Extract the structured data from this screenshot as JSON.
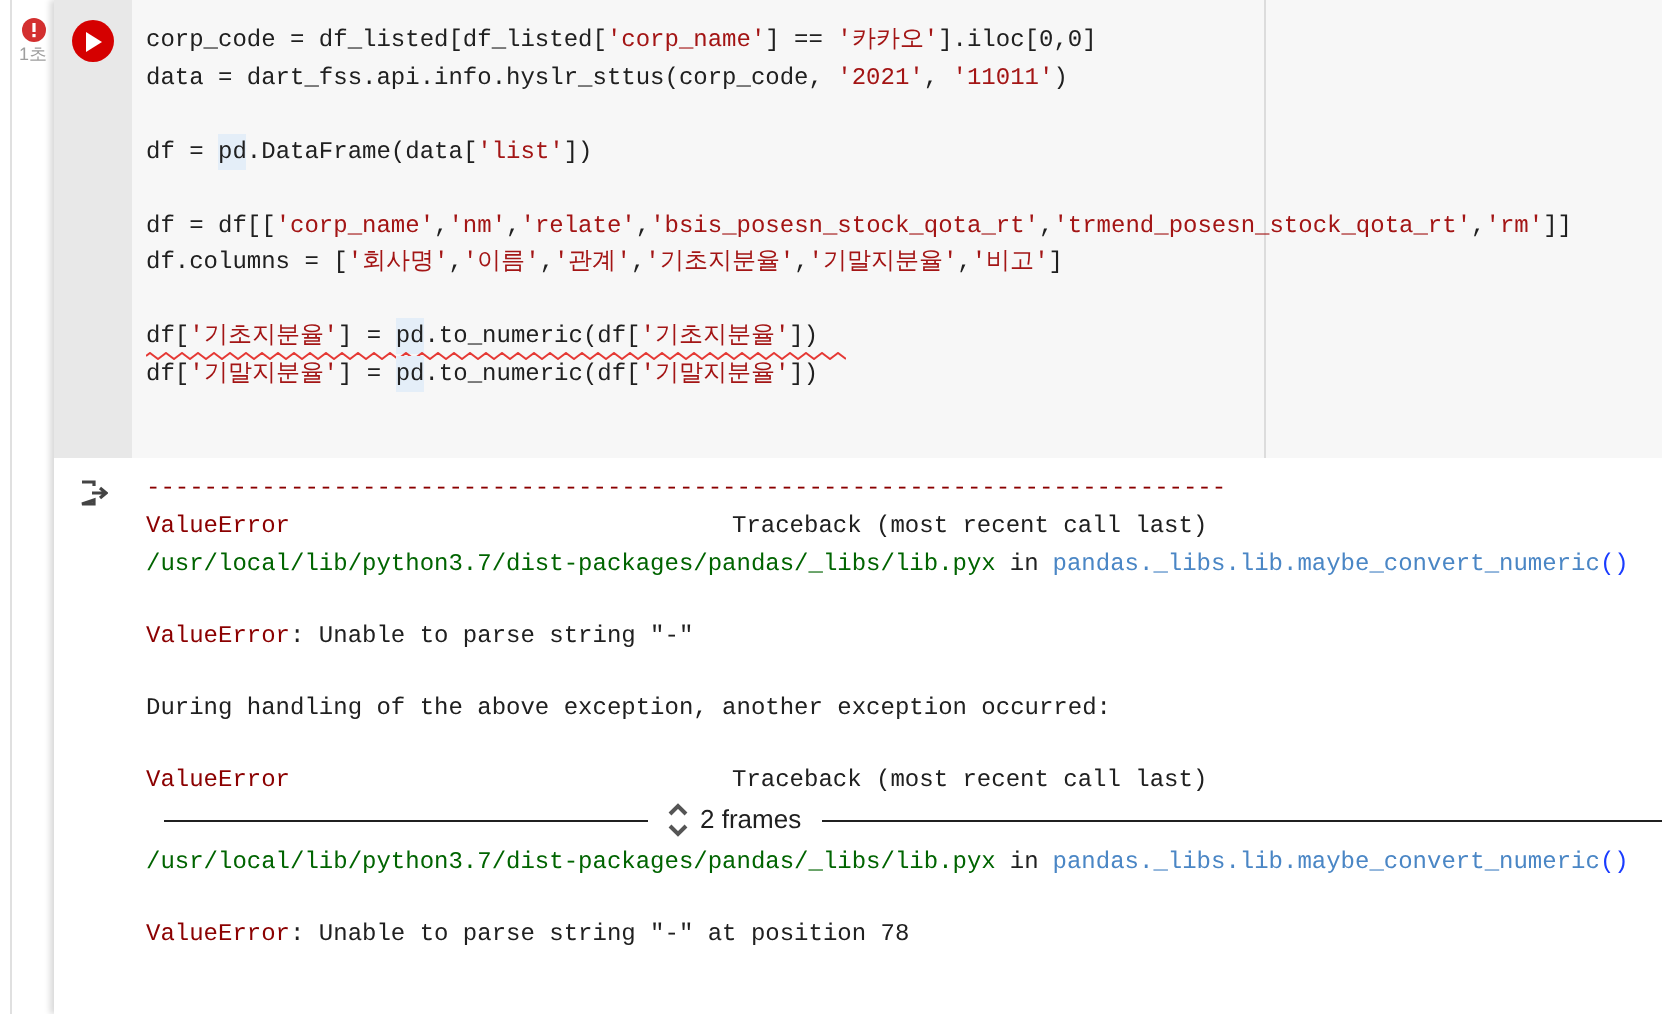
{
  "cell_status": {
    "error": true,
    "duration": "1초"
  },
  "code_blocks": [
    [
      {
        "squiggle": false,
        "tokens": [
          {
            "kind": "code",
            "text": "corp_code = df_listed[df_listed["
          },
          {
            "kind": "string",
            "text": "'corp_name'"
          },
          {
            "kind": "code",
            "text": "] == "
          },
          {
            "kind": "string",
            "text": "'카카오'"
          },
          {
            "kind": "code",
            "text": "].iloc[0,0]"
          }
        ]
      },
      {
        "squiggle": false,
        "tokens": [
          {
            "kind": "code",
            "text": "data = dart_fss.api.info.hyslr_sttus(corp_code, "
          },
          {
            "kind": "string",
            "text": "'2021'"
          },
          {
            "kind": "code",
            "text": ", "
          },
          {
            "kind": "string",
            "text": "'11011'"
          },
          {
            "kind": "code",
            "text": ")"
          }
        ]
      }
    ],
    [
      {
        "squiggle": false,
        "tokens": [
          {
            "kind": "code",
            "text": "df = "
          },
          {
            "kind": "match",
            "text": "pd"
          },
          {
            "kind": "code",
            "text": ".DataFrame(data["
          },
          {
            "kind": "string",
            "text": "'list'"
          },
          {
            "kind": "code",
            "text": "])"
          }
        ]
      }
    ],
    [
      {
        "squiggle": false,
        "tokens": [
          {
            "kind": "code",
            "text": "df = df[["
          },
          {
            "kind": "string",
            "text": "'corp_name'"
          },
          {
            "kind": "code",
            "text": ","
          },
          {
            "kind": "string",
            "text": "'nm'"
          },
          {
            "kind": "code",
            "text": ","
          },
          {
            "kind": "string",
            "text": "'relate'"
          },
          {
            "kind": "code",
            "text": ","
          },
          {
            "kind": "string",
            "text": "'bsis_posesn_stock_qota_rt'"
          },
          {
            "kind": "code",
            "text": ","
          },
          {
            "kind": "string",
            "text": "'trmend_posesn_stock_qota_rt'"
          },
          {
            "kind": "code",
            "text": ","
          },
          {
            "kind": "string",
            "text": "'rm'"
          },
          {
            "kind": "code",
            "text": "]]"
          }
        ]
      },
      {
        "squiggle": false,
        "tokens": [
          {
            "kind": "code",
            "text": "df.columns = ["
          },
          {
            "kind": "string",
            "text": "'회사명'"
          },
          {
            "kind": "code",
            "text": ","
          },
          {
            "kind": "string",
            "text": "'이름'"
          },
          {
            "kind": "code",
            "text": ","
          },
          {
            "kind": "string",
            "text": "'관계'"
          },
          {
            "kind": "code",
            "text": ","
          },
          {
            "kind": "string",
            "text": "'기초지분율'"
          },
          {
            "kind": "code",
            "text": ","
          },
          {
            "kind": "string",
            "text": "'기말지분율'"
          },
          {
            "kind": "code",
            "text": ","
          },
          {
            "kind": "string",
            "text": "'비고'"
          },
          {
            "kind": "code",
            "text": "]"
          }
        ]
      }
    ],
    [
      {
        "squiggle": true,
        "tokens": [
          {
            "kind": "code",
            "text": "df["
          },
          {
            "kind": "string",
            "text": "'기초지분율'"
          },
          {
            "kind": "code",
            "text": "] = "
          },
          {
            "kind": "match",
            "text": "pd"
          },
          {
            "kind": "code",
            "text": ".to_numeric(df["
          },
          {
            "kind": "string",
            "text": "'기초지분율'"
          },
          {
            "kind": "code",
            "text": "])"
          }
        ]
      },
      {
        "squiggle": false,
        "tokens": [
          {
            "kind": "code",
            "text": "df["
          },
          {
            "kind": "string",
            "text": "'기말지분율'"
          },
          {
            "kind": "code",
            "text": "] = "
          },
          {
            "kind": "match",
            "text": "pd"
          },
          {
            "kind": "code",
            "text": ".to_numeric(df["
          },
          {
            "kind": "string",
            "text": "'기말지분율'"
          },
          {
            "kind": "code",
            "text": "])"
          }
        ]
      }
    ]
  ],
  "output_blocks": [
    [
      {
        "kind": "dashes",
        "text": "---------------------------------------------------------------------------"
      },
      {
        "kind": "header",
        "error": "ValueError",
        "note": "Traceback (most recent call last)"
      },
      {
        "kind": "location",
        "path": "/usr/local/lib/python3.7/dist-packages/pandas/_libs/lib.pyx",
        "joiner": "in",
        "func": "pandas._libs.lib.maybe_convert_numeric",
        "call": "()"
      }
    ],
    [
      {
        "kind": "message",
        "error": "ValueError",
        "text": ": Unable to parse string \"-\""
      }
    ],
    [
      {
        "kind": "plain",
        "text": "During handling of the above exception, another exception occurred:"
      }
    ],
    [
      {
        "kind": "header",
        "error": "ValueError",
        "note": "Traceback (most recent call last)"
      },
      {
        "kind": "frames",
        "text": "2 frames"
      },
      {
        "kind": "location",
        "path": "/usr/local/lib/python3.7/dist-packages/pandas/_libs/lib.pyx",
        "joiner": "in",
        "func": "pandas._libs.lib.maybe_convert_numeric",
        "call": "()"
      }
    ],
    [
      {
        "kind": "message",
        "error": "ValueError",
        "text": ": Unable to parse string \"-\" at position 78"
      }
    ]
  ]
}
